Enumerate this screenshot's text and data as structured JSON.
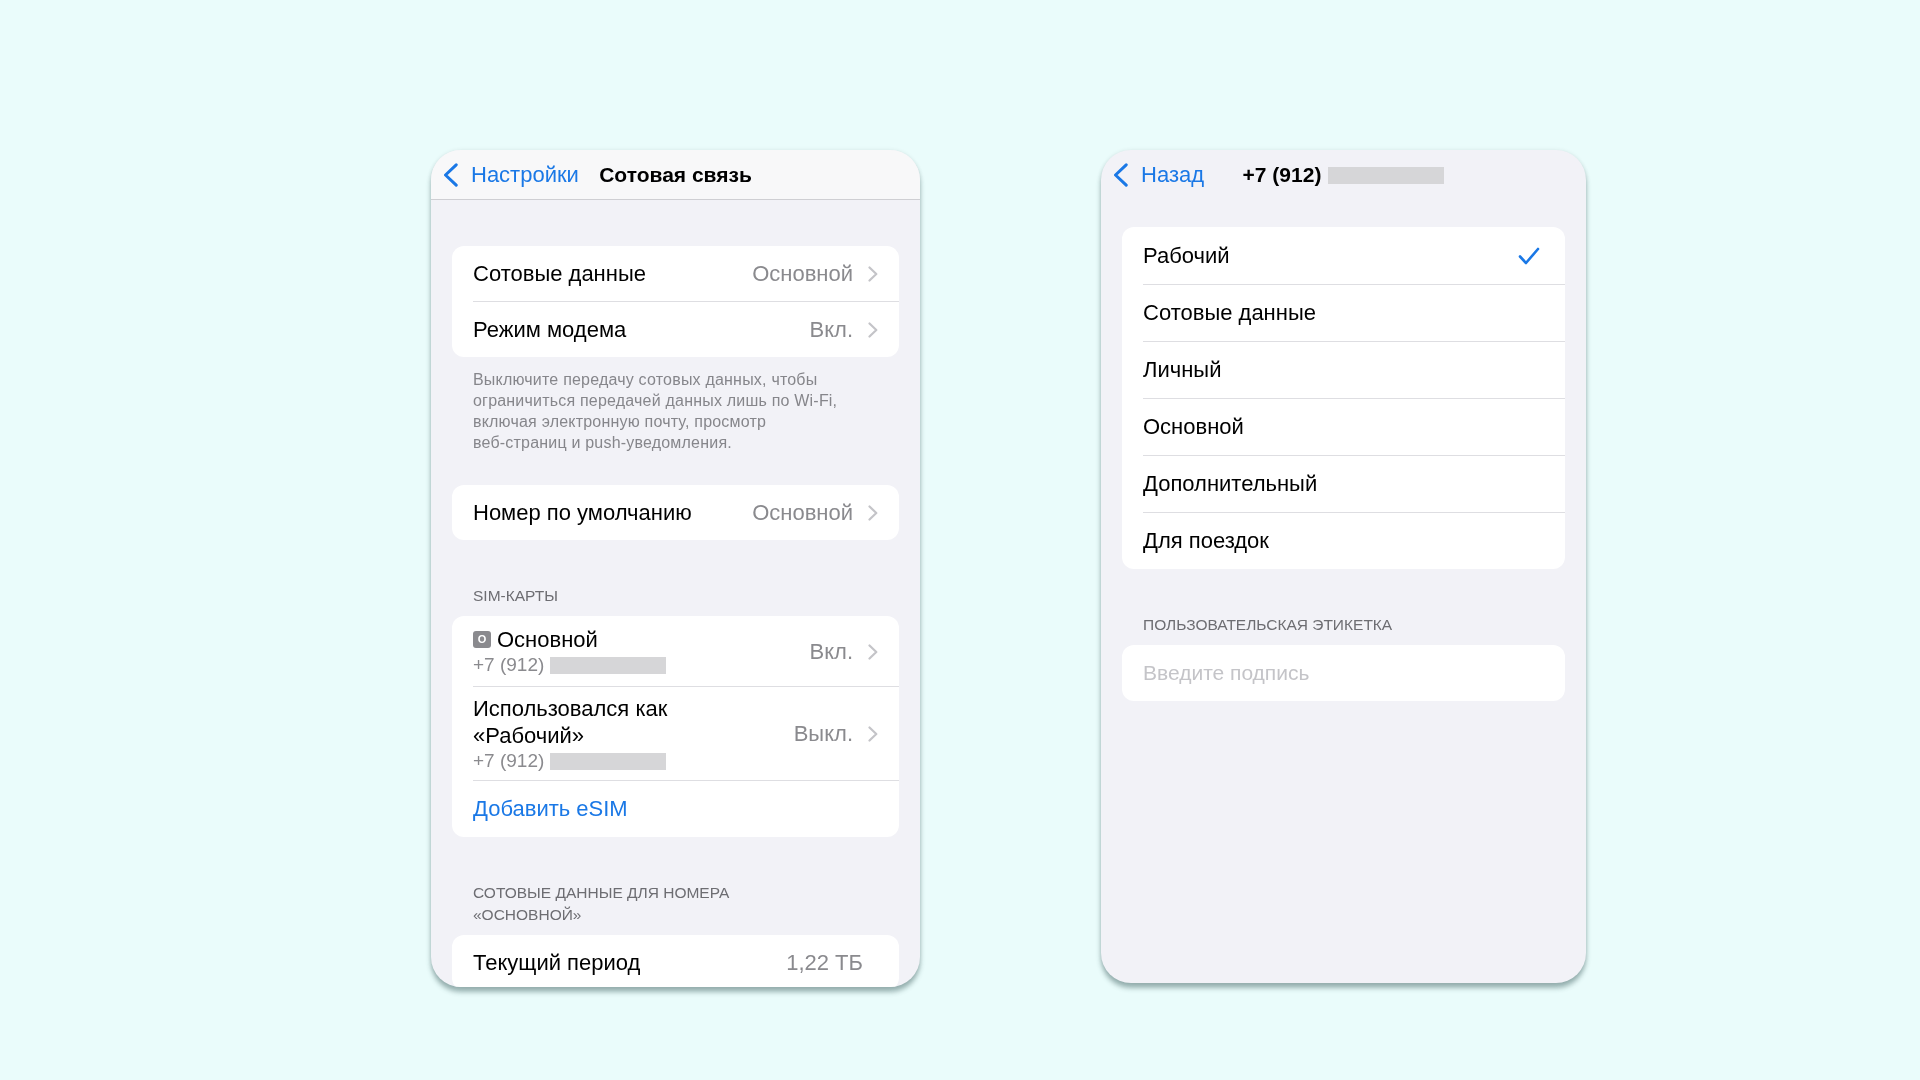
{
  "cellular_screen": {
    "nav_bar": {
      "back_label": "Настройки",
      "title": "Сотовая связь"
    },
    "groups": [
      {
        "rows": [
          {
            "kind": "detail",
            "label": "Сотовые данные",
            "value": "Основной",
            "chevron": true
          },
          {
            "kind": "detail",
            "label": "Режим модема",
            "value": "Вкл.",
            "chevron": true
          }
        ],
        "footer": "Выключите передачу сотовых данных, чтобы ограничиться передачей данных лишь по Wi-Fi, включая электронную почту, просмотр веб-страниц и push-уведомления."
      },
      {
        "rows": [
          {
            "kind": "detail",
            "label": "Номер по умолчанию",
            "value": "Основной",
            "chevron": true
          }
        ]
      },
      {
        "header": "SIM-КАРТЫ",
        "rows": [
          {
            "kind": "sim",
            "tag": "O",
            "label": "Основной",
            "number": "+7 (912)",
            "redacted": true,
            "value": "Вкл.",
            "chevron": true
          },
          {
            "kind": "sim",
            "label": "Использовался как «Рабочий»",
            "number": "+7 (912)",
            "redacted": true,
            "value": "Выкл.",
            "chevron": true
          },
          {
            "kind": "link",
            "label": "Добавить eSIM"
          }
        ]
      },
      {
        "header": "СОТОВЫЕ ДАННЫЕ ДЛЯ НОМЕРА «ОСНОВНОЙ»",
        "rows": [
          {
            "kind": "detail",
            "label": "Текущий период",
            "value": "1,22 ТБ",
            "chevron": false
          }
        ]
      }
    ]
  },
  "label_screen": {
    "nav_bar": {
      "back_label": "Назад",
      "title": "+7 (912)",
      "redacted": true
    },
    "options": [
      {
        "label": "Рабочий",
        "selected": true
      },
      {
        "label": "Сотовые данные",
        "selected": false
      },
      {
        "label": "Личный",
        "selected": false
      },
      {
        "label": "Основной",
        "selected": false
      },
      {
        "label": "Дополнительный",
        "selected": false
      },
      {
        "label": "Для поездок",
        "selected": false
      }
    ],
    "custom_label": {
      "header": "ПОЛЬЗОВАТЕЛЬСКАЯ ЭТИКЕТКА",
      "placeholder": "Введите подпись"
    }
  }
}
